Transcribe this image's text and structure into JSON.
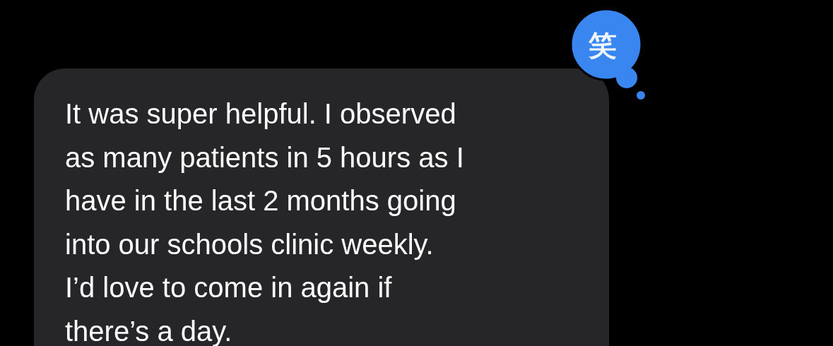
{
  "message": {
    "text": "It was super helpful. I observed\nas many patients in 5 hours as I\nhave in the last 2 months going\ninto our schools clinic weekly.\nI’d love to come in again if\nthere’s a day.",
    "reaction": {
      "glyph": "笑"
    }
  }
}
